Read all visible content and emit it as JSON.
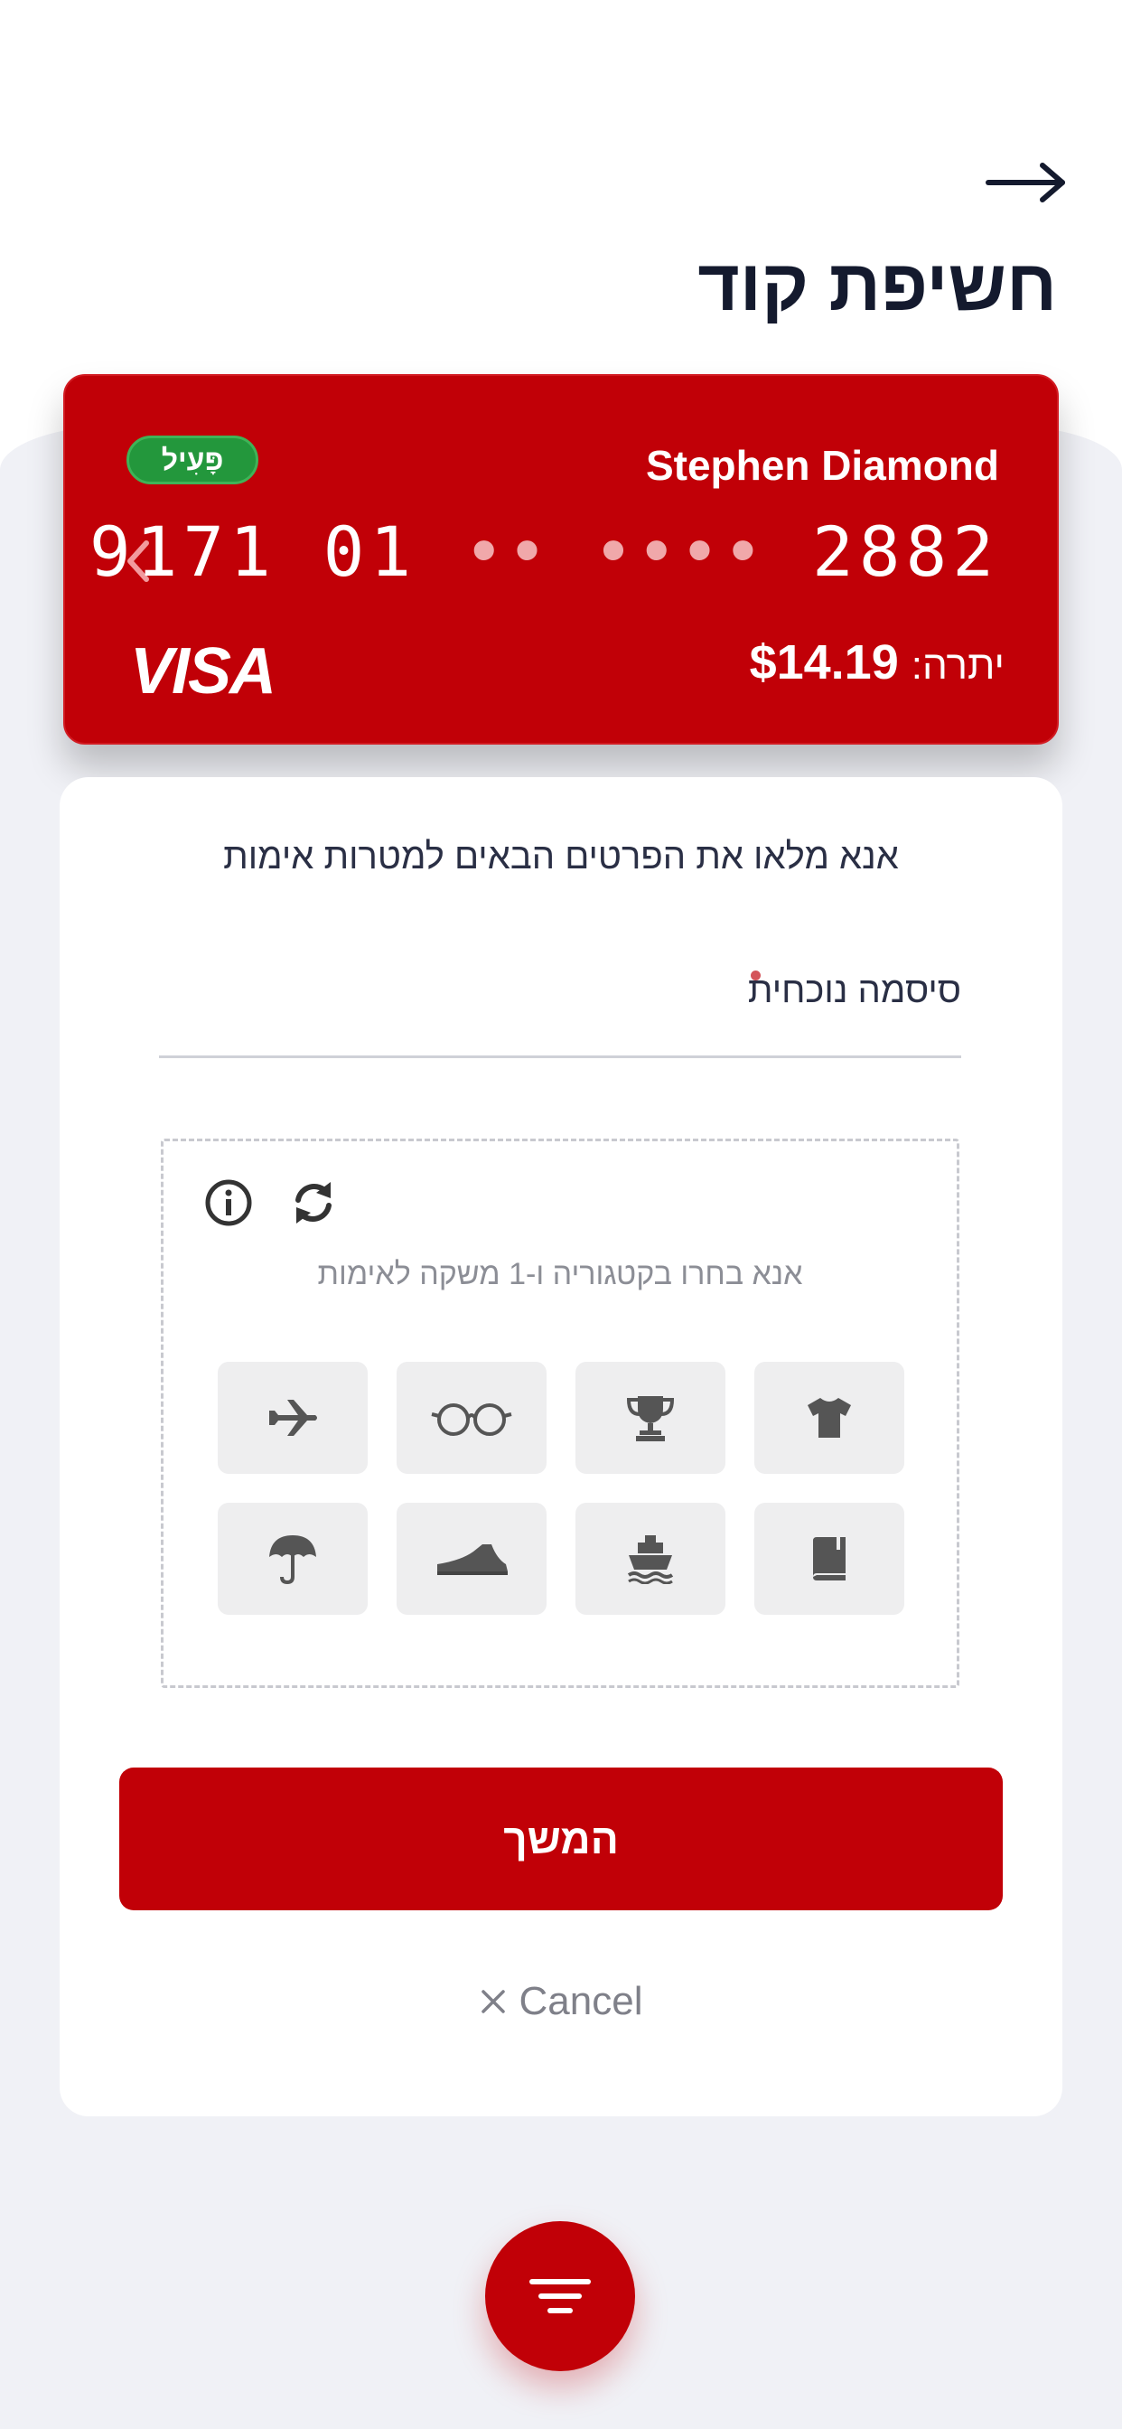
{
  "header": {
    "title": "חשיפת קוד",
    "back_icon": "arrow-right-icon"
  },
  "card": {
    "status": "פָּעִיל",
    "holder": "Stephen Diamond",
    "number_start": "9171 01",
    "number_masked": "•• ••••",
    "number_end": "2882",
    "network": "VISA",
    "balance_label": "יתרה:",
    "balance_value": "$14.19",
    "colors": {
      "card_bg": "#c10007",
      "status_bg": "#23973c"
    }
  },
  "form": {
    "instructions": "אנא מלאו את הפרטים הבאים למטרות אימות",
    "password_label": "סיסמה נוכחית",
    "password_value": "",
    "captcha_hint": "אנא בחרו בקטגוריה ו-1 משקה לאימות",
    "captcha_icons": [
      "info-icon",
      "refresh-icon"
    ],
    "captcha_tiles": [
      "airplane-icon",
      "glasses-icon",
      "trophy-icon",
      "tshirt-icon",
      "umbrella-icon",
      "shoe-icon",
      "ship-icon",
      "book-icon"
    ],
    "continue_label": "המשך",
    "cancel_label": "Cancel"
  },
  "fab": {
    "icon": "menu-icon"
  },
  "colors": {
    "accent": "#c10007",
    "background": "#f0f1f6",
    "text_dark": "#141a2e"
  }
}
